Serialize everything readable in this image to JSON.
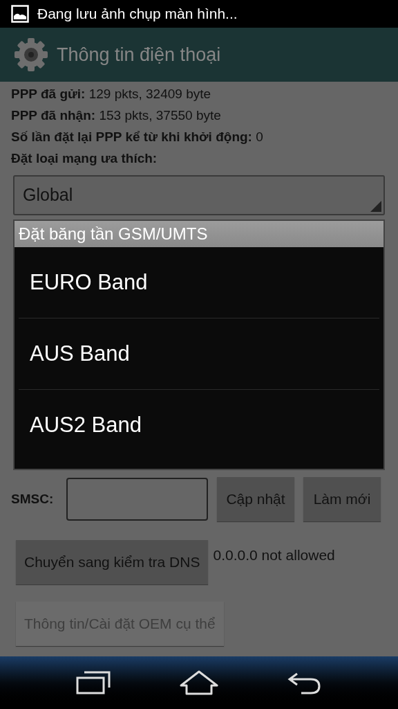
{
  "status_bar": {
    "notification": "Đang lưu ảnh chụp màn hình..."
  },
  "app_bar": {
    "title": "Thông tin điện thoại"
  },
  "info_lines": [
    {
      "label": "PPP đã gửi:",
      "value": "129 pkts, 32409 byte"
    },
    {
      "label": "PPP đã nhận:",
      "value": "153 pkts, 37550 byte"
    },
    {
      "label": "Số lần đặt lại PPP kể từ khi khởi động:",
      "value": "0"
    }
  ],
  "preferred_network": {
    "label": "Đặt loại mạng ưa thích:",
    "value": "Global"
  },
  "dialog": {
    "title": "Đặt băng tần GSM/UMTS",
    "items": [
      {
        "label": "EURO Band"
      },
      {
        "label": "AUS Band"
      },
      {
        "label": "AUS2 Band"
      }
    ]
  },
  "smsc": {
    "label": "SMSC:",
    "buttons": [
      {
        "label": "Cập nhật",
        "disabled": false
      },
      {
        "label": "Làm mới",
        "disabled": false
      }
    ]
  },
  "dns": {
    "button": {
      "label": "Chuyển sang kiểm tra DNS",
      "disabled": false
    },
    "status": "0.0.0.0 not allowed"
  },
  "oem_button": {
    "label": "Thông tin/Cài đặt OEM cụ thể",
    "disabled": true
  }
}
